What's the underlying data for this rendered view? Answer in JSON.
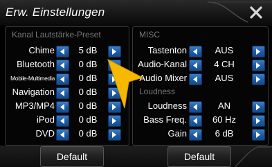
{
  "window": {
    "title": "Erw. Einstellungen",
    "close_icon": "close-icon"
  },
  "left_panel": {
    "header": "Kanal Lautstärke-Preset",
    "rows": [
      {
        "label": "Chime",
        "value": "5 dB"
      },
      {
        "label": "Bluetooth",
        "value": "0 dB"
      },
      {
        "label": "Mobile-Multimedia",
        "value": "0 dB"
      },
      {
        "label": "Navigation",
        "value": "0 dB"
      },
      {
        "label": "MP3/MP4",
        "value": "0 dB"
      },
      {
        "label": "iPod",
        "value": "0 dB"
      },
      {
        "label": "DVD",
        "value": "0 dB"
      }
    ]
  },
  "right_panel": {
    "misc_header": "MISC",
    "misc_rows": [
      {
        "label": "Tastenton",
        "value": "AUS"
      },
      {
        "label": "Audio-Kanal",
        "value": "4 CH"
      },
      {
        "label": "Audio Mixer",
        "value": "AUS"
      }
    ],
    "loudness_header": "Loudness",
    "loudness_rows": [
      {
        "label": "Loudness",
        "value": "AN"
      },
      {
        "label": "Bass Freq.",
        "value": "60 Hz"
      },
      {
        "label": "Gain",
        "value": "6 dB"
      }
    ]
  },
  "bottom_bar": {
    "default_left_label": "Default",
    "default_right_label": "Default"
  },
  "icons": {
    "decrement": "chevron-left-icon",
    "increment": "chevron-right-icon",
    "pointer": "pointer-arrow-icon"
  },
  "colors": {
    "button_blue": "#1e5aa3",
    "pointer_yellow": "#f7b800",
    "header_gray": "#7a7a7a"
  }
}
